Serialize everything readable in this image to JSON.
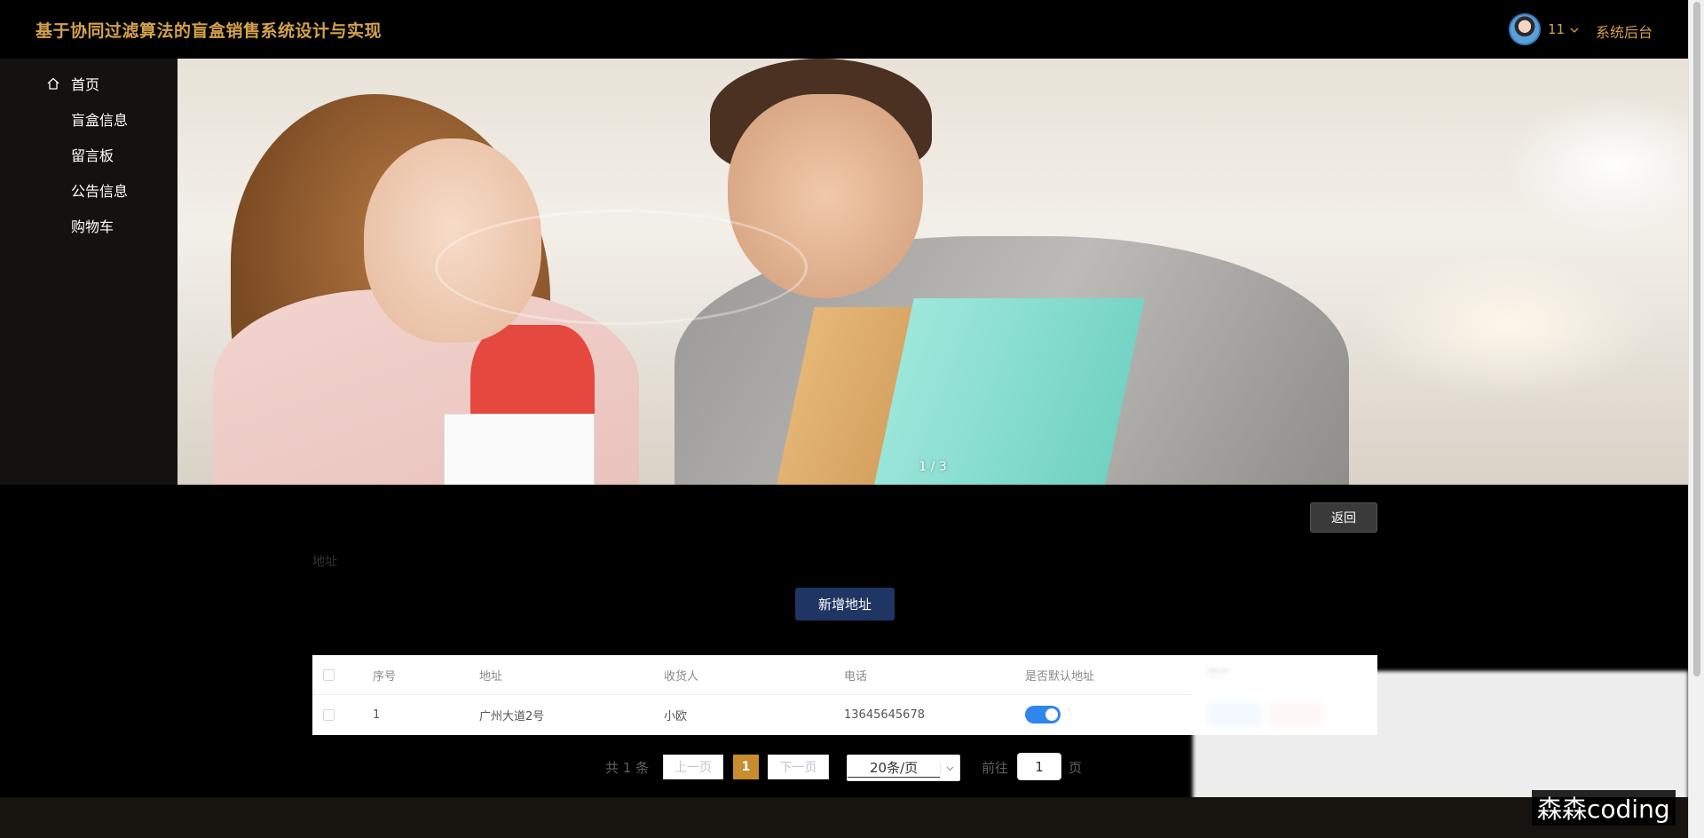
{
  "header": {
    "title": "基于协同过滤算法的盲盒销售系统设计与实现",
    "user_name": "11",
    "backend_link": "系统后台"
  },
  "sidebar": {
    "items": [
      {
        "label": "首页",
        "icon": "home-icon"
      },
      {
        "label": "盲盒信息"
      },
      {
        "label": "留言板"
      },
      {
        "label": "公告信息"
      },
      {
        "label": "购物车"
      }
    ]
  },
  "banner": {
    "counter": "1 / 3"
  },
  "content": {
    "back_button": "返回",
    "section_label": "地址",
    "add_button": "新增地址"
  },
  "table": {
    "columns": [
      "序号",
      "地址",
      "收货人",
      "电话",
      "是否默认地址",
      "操作"
    ],
    "rows": [
      {
        "index": "1",
        "address": "广州大道2号",
        "receiver": "小欧",
        "phone": "13645645678",
        "is_default": true
      }
    ]
  },
  "pagination": {
    "total": "共 1 条",
    "prev": "上一页",
    "current": "1",
    "next": "下一页",
    "page_size": "20条/页",
    "goto_label": "前往",
    "goto_value": "1",
    "goto_suffix": "页"
  },
  "watermark": "森森coding",
  "colors": {
    "accent": "#d4a24c",
    "primary_button": "#1f3563",
    "switch_on": "#2f86ec",
    "page_active": "#c78d2e"
  }
}
